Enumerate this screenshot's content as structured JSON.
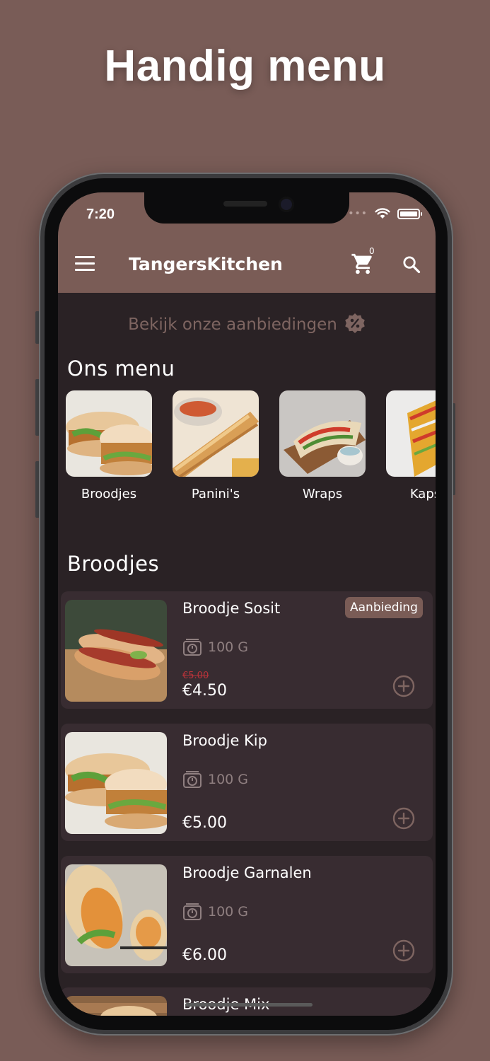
{
  "promo": {
    "headline": "Handig menu"
  },
  "status_bar": {
    "time": "7:20"
  },
  "app_bar": {
    "title": "TangersKitchen",
    "cart_count": "0",
    "accent": "#7a5c56"
  },
  "offers_link": {
    "label": "Bekijk onze aanbiedingen",
    "icon": "discount-badge-icon"
  },
  "menu_section": {
    "title": "Ons menu",
    "categories": [
      {
        "label": "Broodjes"
      },
      {
        "label": "Panini's"
      },
      {
        "label": "Wraps"
      },
      {
        "label": "Kapsa"
      }
    ]
  },
  "products_section": {
    "title": "Broodjes",
    "items": [
      {
        "name": "Broodje Sosit",
        "weight": "100 G",
        "old_price": "€5.00",
        "price": "€4.50",
        "tag": "Aanbieding"
      },
      {
        "name": "Broodje Kip",
        "weight": "100 G",
        "price": "€5.00"
      },
      {
        "name": "Broodje Garnalen",
        "weight": "100 G",
        "price": "€6.00"
      },
      {
        "name": "Broodje Mix"
      }
    ]
  }
}
